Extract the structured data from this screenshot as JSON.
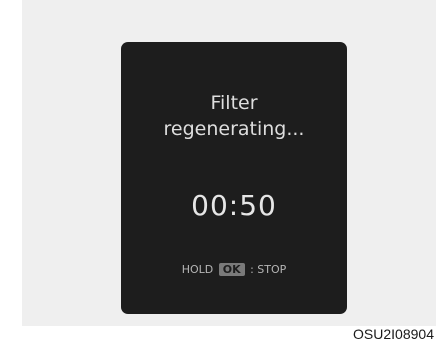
{
  "display": {
    "title_line1": "Filter",
    "title_line2": "regenerating...",
    "timer": "00:50",
    "hint_prefix": "HOLD",
    "hint_key": "OK",
    "hint_suffix": ": STOP"
  },
  "figure_code": "OSU2I08904"
}
